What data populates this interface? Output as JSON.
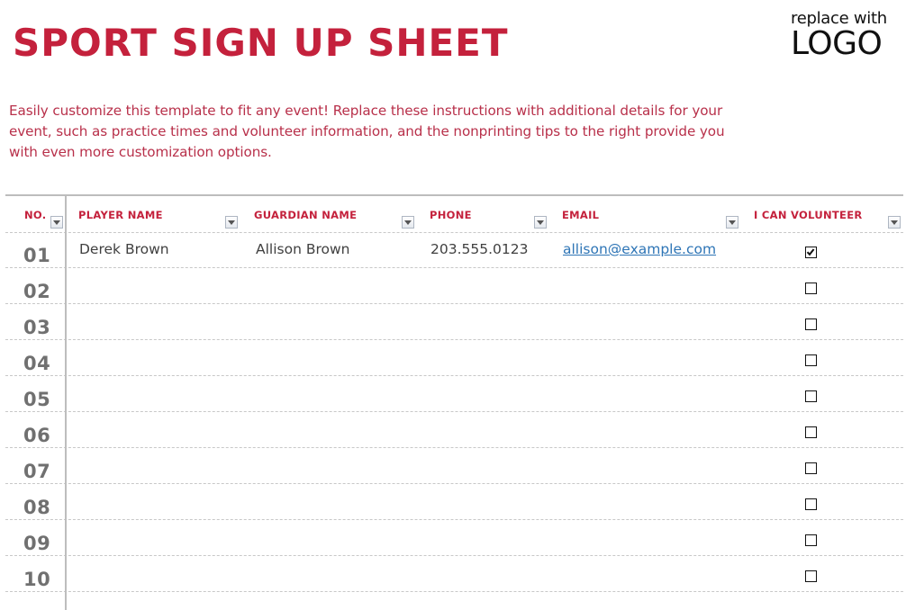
{
  "page": {
    "title": "SPORT SIGN UP SHEET",
    "logo": {
      "small": "replace with",
      "big": "LOGO"
    },
    "intro": "Easily customize this template to fit any event! Replace these instructions with additional details for your event, such as practice times and volunteer information, and the nonprinting tips to the right provide you with even more customization options."
  },
  "colors": {
    "accent": "#C4213C",
    "intro_text": "#B8304A",
    "number_gray": "#707070",
    "link": "#2E75B6",
    "rule": "#BDBDBD"
  },
  "table": {
    "columns": [
      {
        "key": "no",
        "label": "NO."
      },
      {
        "key": "player",
        "label": "PLAYER NAME"
      },
      {
        "key": "guardian",
        "label": "GUARDIAN NAME"
      },
      {
        "key": "phone",
        "label": "PHONE"
      },
      {
        "key": "email",
        "label": "EMAIL"
      },
      {
        "key": "volunteer",
        "label": "I CAN VOLUNTEER"
      }
    ],
    "filter_icon": "dropdown-arrow-icon",
    "rows": [
      {
        "no": "01",
        "player": "Derek Brown",
        "guardian": "Allison Brown",
        "phone": "203.555.0123",
        "email": "allison@example.com",
        "volunteer": true
      },
      {
        "no": "02",
        "player": "",
        "guardian": "",
        "phone": "",
        "email": "",
        "volunteer": false
      },
      {
        "no": "03",
        "player": "",
        "guardian": "",
        "phone": "",
        "email": "",
        "volunteer": false
      },
      {
        "no": "04",
        "player": "",
        "guardian": "",
        "phone": "",
        "email": "",
        "volunteer": false
      },
      {
        "no": "05",
        "player": "",
        "guardian": "",
        "phone": "",
        "email": "",
        "volunteer": false
      },
      {
        "no": "06",
        "player": "",
        "guardian": "",
        "phone": "",
        "email": "",
        "volunteer": false
      },
      {
        "no": "07",
        "player": "",
        "guardian": "",
        "phone": "",
        "email": "",
        "volunteer": false
      },
      {
        "no": "08",
        "player": "",
        "guardian": "",
        "phone": "",
        "email": "",
        "volunteer": false
      },
      {
        "no": "09",
        "player": "",
        "guardian": "",
        "phone": "",
        "email": "",
        "volunteer": false
      },
      {
        "no": "10",
        "player": "",
        "guardian": "",
        "phone": "",
        "email": "",
        "volunteer": false
      }
    ]
  }
}
